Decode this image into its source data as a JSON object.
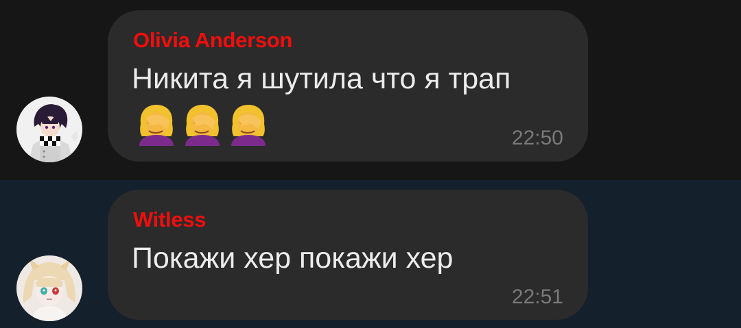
{
  "messages": [
    {
      "sender": "Olivia Anderson",
      "text": "Никита я шутила что я трап",
      "emojis": [
        "face-palm-woman-icon",
        "face-palm-woman-icon",
        "face-palm-woman-icon"
      ],
      "time": "22:50"
    },
    {
      "sender": "Witless",
      "text": "Покажи хер покажи хер",
      "time": "22:51"
    }
  ],
  "colors": {
    "sender_name": "#f20d0d",
    "bubble": "#2b2b2b",
    "row_bg_1": "#161616",
    "row_bg_2": "#15202d",
    "message_text": "#ececec",
    "time_text": "#7a7a7a"
  }
}
